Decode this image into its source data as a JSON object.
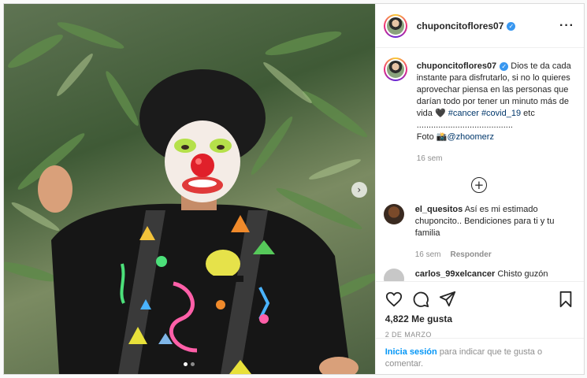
{
  "post": {
    "username": "chuponcitoflores07",
    "verified_badge": "✓",
    "more_icon": "···",
    "image_alt": "",
    "next_icon": "›"
  },
  "caption": {
    "username": "chuponcitoflores07",
    "text": "Dios te da cada instante para disfrutarlo, si no lo quieres aprovechar piensa en las personas que darían todo por tener un minuto más de vida ",
    "heart": "🖤",
    "tag1": "#cancer",
    "tag2": "#covid_19",
    "etc": " etc ........................................",
    "photo_prefix": "Foto 📸",
    "mention": "@zhoomerz",
    "time": "16 sem"
  },
  "load_more_icon": "+",
  "comments": [
    {
      "username": "el_quesitos",
      "text": "Así es mi estimado chuponcito.. Bendiciones para ti y tu familia",
      "time": "16 sem",
      "reply": "Responder"
    },
    {
      "username": "carlos_99xelcancer",
      "text": "Chisto guzón"
    }
  ],
  "actions": {
    "likes": "4,822 Me gusta",
    "date": "2 DE MARZO"
  },
  "login": {
    "link": "Inicia sesión",
    "text": " para indicar que te gusta o comentar."
  },
  "colors": {
    "link": "#00376b",
    "login_link": "#0095f6",
    "verified": "#3897f0"
  }
}
